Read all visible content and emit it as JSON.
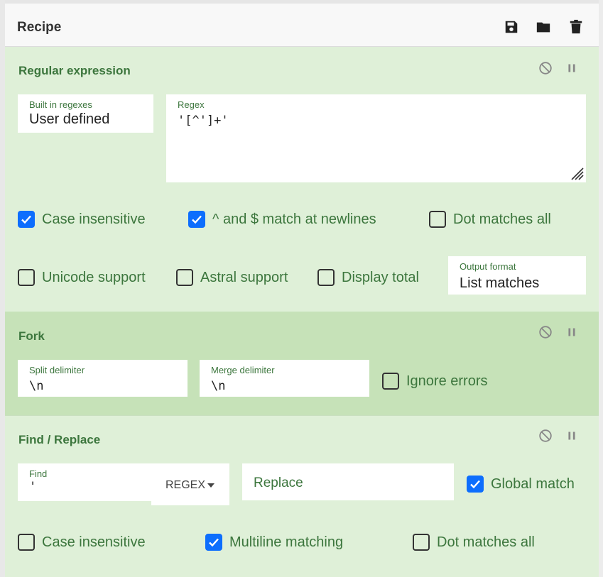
{
  "header": {
    "title": "Recipe"
  },
  "regex_op": {
    "title": "Regular expression",
    "builtin": {
      "label": "Built in regexes",
      "value": "User defined"
    },
    "regex": {
      "label": "Regex",
      "value": "'[^']+'"
    },
    "options": [
      {
        "label": "Case insensitive",
        "checked": true
      },
      {
        "label": "^ and $ match at newlines",
        "checked": true
      },
      {
        "label": "Dot matches all",
        "checked": false
      },
      {
        "label": "Unicode support",
        "checked": false
      },
      {
        "label": "Astral support",
        "checked": false
      },
      {
        "label": "Display total",
        "checked": false
      }
    ],
    "output_format": {
      "label": "Output format",
      "value": "List matches"
    }
  },
  "fork_op": {
    "title": "Fork",
    "split": {
      "label": "Split delimiter",
      "value": "\\n"
    },
    "merge": {
      "label": "Merge delimiter",
      "value": "\\n"
    },
    "ignore_errors": {
      "label": "Ignore errors",
      "checked": false
    }
  },
  "find_op": {
    "title": "Find / Replace",
    "find": {
      "label": "Find",
      "value": "'",
      "mode": "REGEX"
    },
    "replace": {
      "placeholder": "Replace"
    },
    "global_match": {
      "label": "Global match",
      "checked": true
    },
    "case_insensitive": {
      "label": "Case insensitive",
      "checked": false
    },
    "multiline": {
      "label": "Multiline matching",
      "checked": true
    },
    "dot_all": {
      "label": "Dot matches all",
      "checked": false
    }
  },
  "colors": {
    "op_bg": "#dff0d8",
    "fork_bg": "#c6e2b8",
    "label_green": "#3c763d",
    "check_blue": "#0d6efd"
  },
  "icons": {
    "save": "floppy-disk-icon",
    "load": "folder-icon",
    "clear": "trash-icon",
    "disable": "circle-slash-icon",
    "breakpoint": "pause-icon"
  }
}
